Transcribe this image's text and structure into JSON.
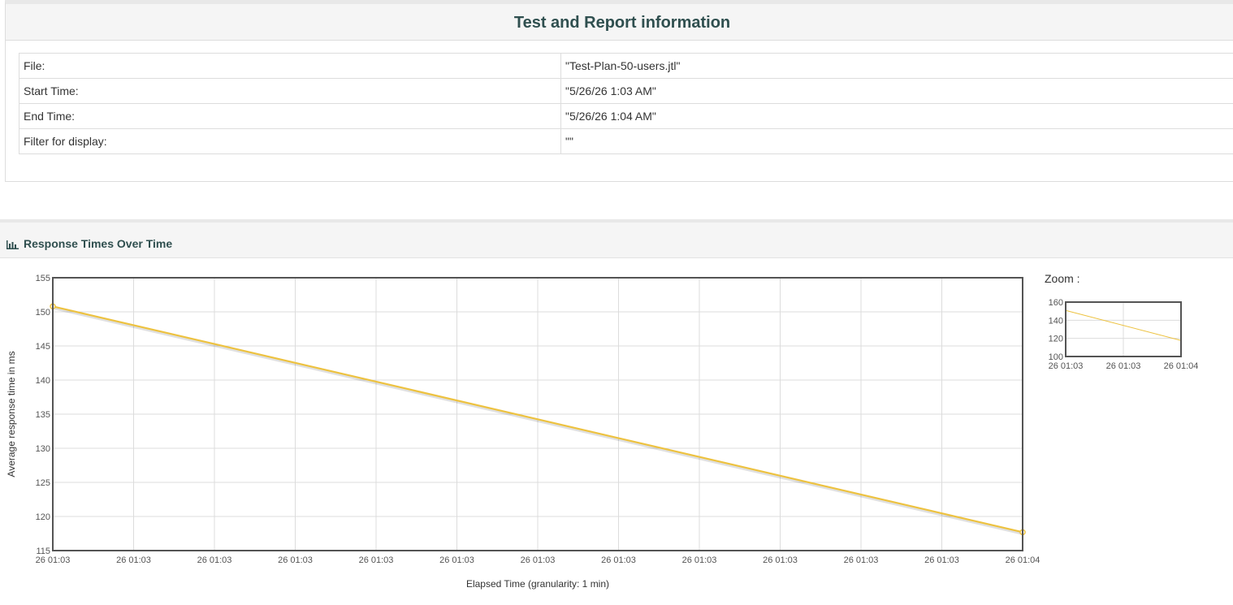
{
  "report_info": {
    "title": "Test and Report information",
    "rows": [
      {
        "label": "File:",
        "value": "\"Test-Plan-50-users.jtl\""
      },
      {
        "label": "Start Time:",
        "value": "\"5/26/26 1:03 AM\""
      },
      {
        "label": "End Time:",
        "value": "\"5/26/26 1:04 AM\""
      },
      {
        "label": "Filter for display:",
        "value": "\"\""
      }
    ]
  },
  "response_panel": {
    "title": "Response Times Over Time",
    "icon": "bar-chart-icon",
    "zoom_label": "Zoom :"
  },
  "chart_data": [
    {
      "type": "line",
      "ylabel": "Average response time in ms",
      "xlabel": "Elapsed Time (granularity: 1 min)",
      "ylim": [
        115,
        155
      ],
      "yticks": [
        "155",
        "150",
        "145",
        "140",
        "135",
        "130",
        "125",
        "120",
        "115"
      ],
      "xticks": [
        "26 01:03",
        "26 01:03",
        "26 01:03",
        "26 01:03",
        "26 01:03",
        "26 01:03",
        "26 01:03",
        "26 01:03",
        "26 01:03",
        "26 01:03",
        "26 01:03",
        "26 01:03",
        "26 01:04"
      ],
      "grid": true,
      "color": "#edc240",
      "series": [
        {
          "x": [
            "26 01:03",
            "26 01:04"
          ],
          "values": [
            150.8,
            117.7
          ]
        }
      ]
    },
    {
      "type": "line",
      "ylim": [
        100,
        160
      ],
      "yticks": [
        "160",
        "140",
        "120",
        "100"
      ],
      "xticks": [
        "26 01:03",
        "26 01:03",
        "26 01:04"
      ],
      "grid": true,
      "color": "#edc240",
      "series": [
        {
          "x": [
            "26 01:03",
            "26 01:04"
          ],
          "values": [
            150.8,
            117.7
          ]
        }
      ]
    }
  ]
}
